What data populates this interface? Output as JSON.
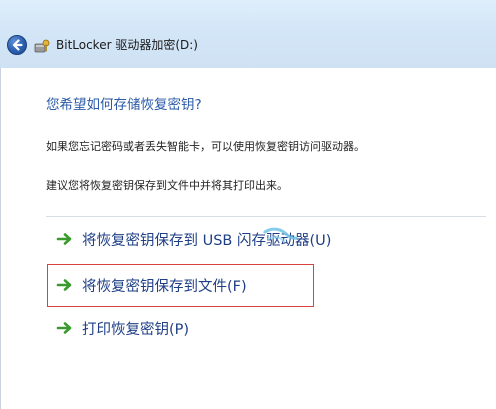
{
  "window": {
    "title": "BitLocker 驱动器加密(D:)"
  },
  "icons": {
    "back": "back-arrow-icon",
    "app": "bitlocker-key-icon",
    "option_arrow": "green-arrow-icon"
  },
  "colors": {
    "heading": "#2a5aa8",
    "option_text": "#1f3f86",
    "arrow": "#3a9a2e",
    "highlight": "#d94242"
  },
  "main": {
    "heading": "您希望如何存储恢复密钥?",
    "description": "如果您忘记密码或者丢失智能卡，可以使用恢复密钥访问驱动器。",
    "recommendation": "建议您将恢复密钥保存到文件中并将其打印出来。",
    "options": [
      {
        "label": "将恢复密钥保存到 USB 闪存驱动器(U)"
      },
      {
        "label": "将恢复密钥保存到文件(F)"
      },
      {
        "label": "打印恢复密钥(P)"
      }
    ]
  }
}
